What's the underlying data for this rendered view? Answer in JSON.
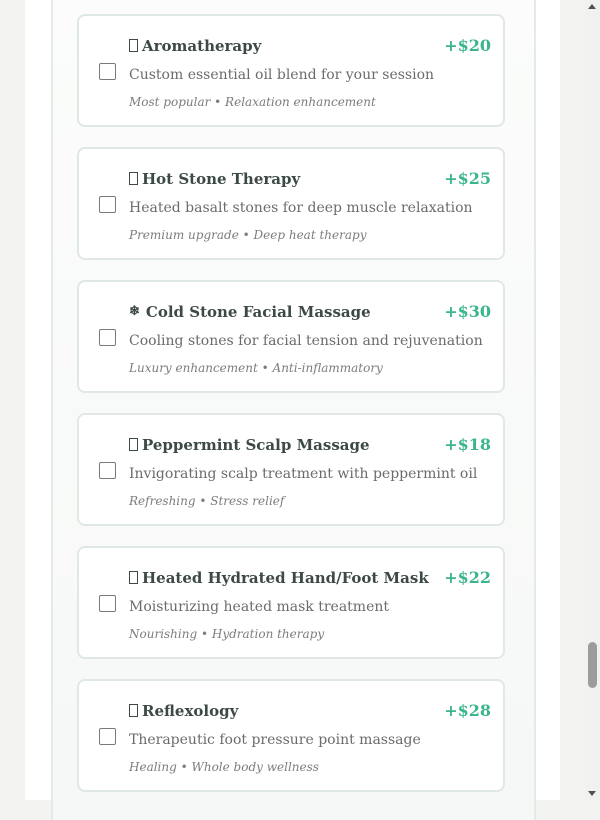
{
  "addons": [
    {
      "icon": "spa-icon",
      "title": "Aromatherapy",
      "price": "+$20",
      "description": "Custom essential oil blend for your session",
      "tags": "Most popular • Relaxation enhancement"
    },
    {
      "icon": "stone-icon",
      "title": "Hot Stone Therapy",
      "price": "+$25",
      "description": "Heated basalt stones for deep muscle relaxation",
      "tags": "Premium upgrade • Deep heat therapy"
    },
    {
      "icon": "snowflake-icon",
      "icon_glyph": "❄",
      "title": "Cold Stone Facial Massage",
      "price": "+$30",
      "description": "Cooling stones for facial tension and rejuvenation",
      "tags": "Luxury enhancement • Anti-inflammatory"
    },
    {
      "icon": "leaf-icon",
      "title": "Peppermint Scalp Massage",
      "price": "+$18",
      "description": "Invigorating scalp treatment with peppermint oil",
      "tags": "Refreshing • Stress relief"
    },
    {
      "icon": "hand-icon",
      "title": "Heated Hydrated Hand/Foot Mask",
      "price": "+$22",
      "description": "Moisturizing heated mask treatment",
      "tags": "Nourishing • Hydration therapy"
    },
    {
      "icon": "foot-icon",
      "title": "Reflexology",
      "price": "+$28",
      "description": "Therapeutic foot pressure point massage",
      "tags": "Healing • Whole body wellness"
    }
  ]
}
